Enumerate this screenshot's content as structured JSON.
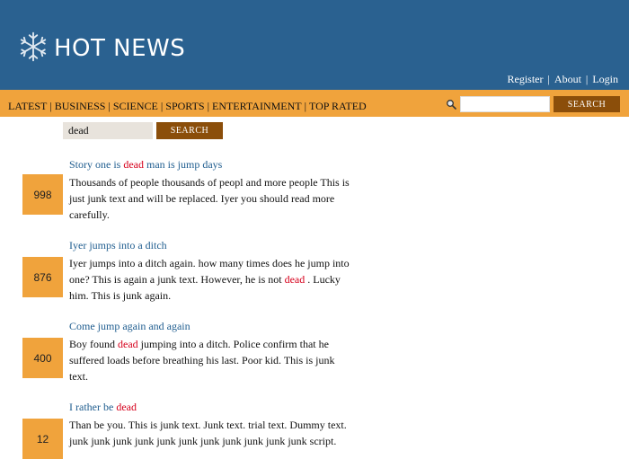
{
  "header": {
    "logo_text": "HOT NEWS",
    "links": {
      "register": "Register",
      "about": "About",
      "login": "Login"
    },
    "bg_color": "#2a6190"
  },
  "nav": {
    "items": [
      "LATEST",
      "BUSINESS",
      "SCIENCE",
      "SPORTS",
      "ENTERTAINMENT",
      "TOP RATED"
    ],
    "search_placeholder": "",
    "search_button": "SEARCH",
    "bg_color": "#f0a33c"
  },
  "search": {
    "value": "dead",
    "button": "SEARCH"
  },
  "highlight_color": "#d6001c",
  "stories": [
    {
      "score": "998",
      "title_pre": "Story one is ",
      "title_hl": "dead",
      "title_post": " man is jump days",
      "body_pre": "Thousands of people thousands of peopl and more people This is just junk text and will be replaced. Iyer you should read more carefully.",
      "body_hl": "",
      "body_post": ""
    },
    {
      "score": "876",
      "title_pre": "Iyer jumps into a ditch",
      "title_hl": "",
      "title_post": "",
      "body_pre": "Iyer jumps into a ditch again. how many times does he jump into one? This is again a junk text. However, he is not ",
      "body_hl": "dead",
      "body_post": " . Lucky him. This is junk again."
    },
    {
      "score": "400",
      "title_pre": "Come jump again and again",
      "title_hl": "",
      "title_post": "",
      "body_pre": "Boy found ",
      "body_hl": "dead",
      "body_post": " jumping into a ditch. Police confirm that he suffered loads before breathing his last. Poor kid. This is junk text."
    },
    {
      "score": "12",
      "title_pre": "I rather be ",
      "title_hl": "dead",
      "title_post": "",
      "body_pre": "Than be you. This is junk text. Junk text. trial text. Dummy text. junk junk junk junk junk junk junk junk junk junk junk script.",
      "body_hl": "",
      "body_post": ""
    }
  ]
}
